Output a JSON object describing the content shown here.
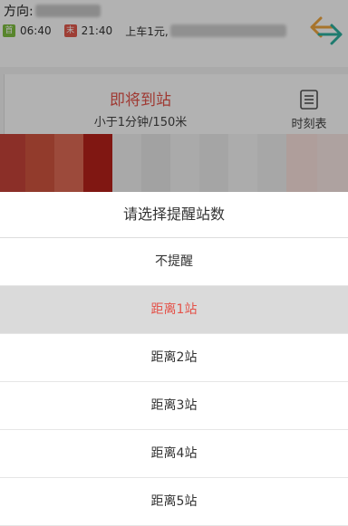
{
  "route": {
    "direction_label": "方向:",
    "first_bus_badge": "首",
    "first_bus_time": "06:40",
    "last_bus_badge": "末",
    "last_bus_time": "21:40",
    "fare_text": "上车1元,"
  },
  "arrival": {
    "status": "即将到站",
    "distance": "小于1分钟/150米",
    "timetable_label": "时刻表"
  },
  "colors": {
    "accent_red": "#e4534a",
    "first_badge_green": "#7fbf3f",
    "last_badge_red": "#e25a4c",
    "selected_row_bg": "#dadada"
  },
  "reminder_sheet": {
    "title": "请选择提醒站数",
    "selected_index": 1,
    "options": [
      "不提醒",
      "距离1站",
      "距离2站",
      "距离3站",
      "距离4站",
      "距离5站"
    ]
  },
  "icons": {
    "swap": "swap-direction-icon",
    "timetable": "timetable-icon"
  }
}
